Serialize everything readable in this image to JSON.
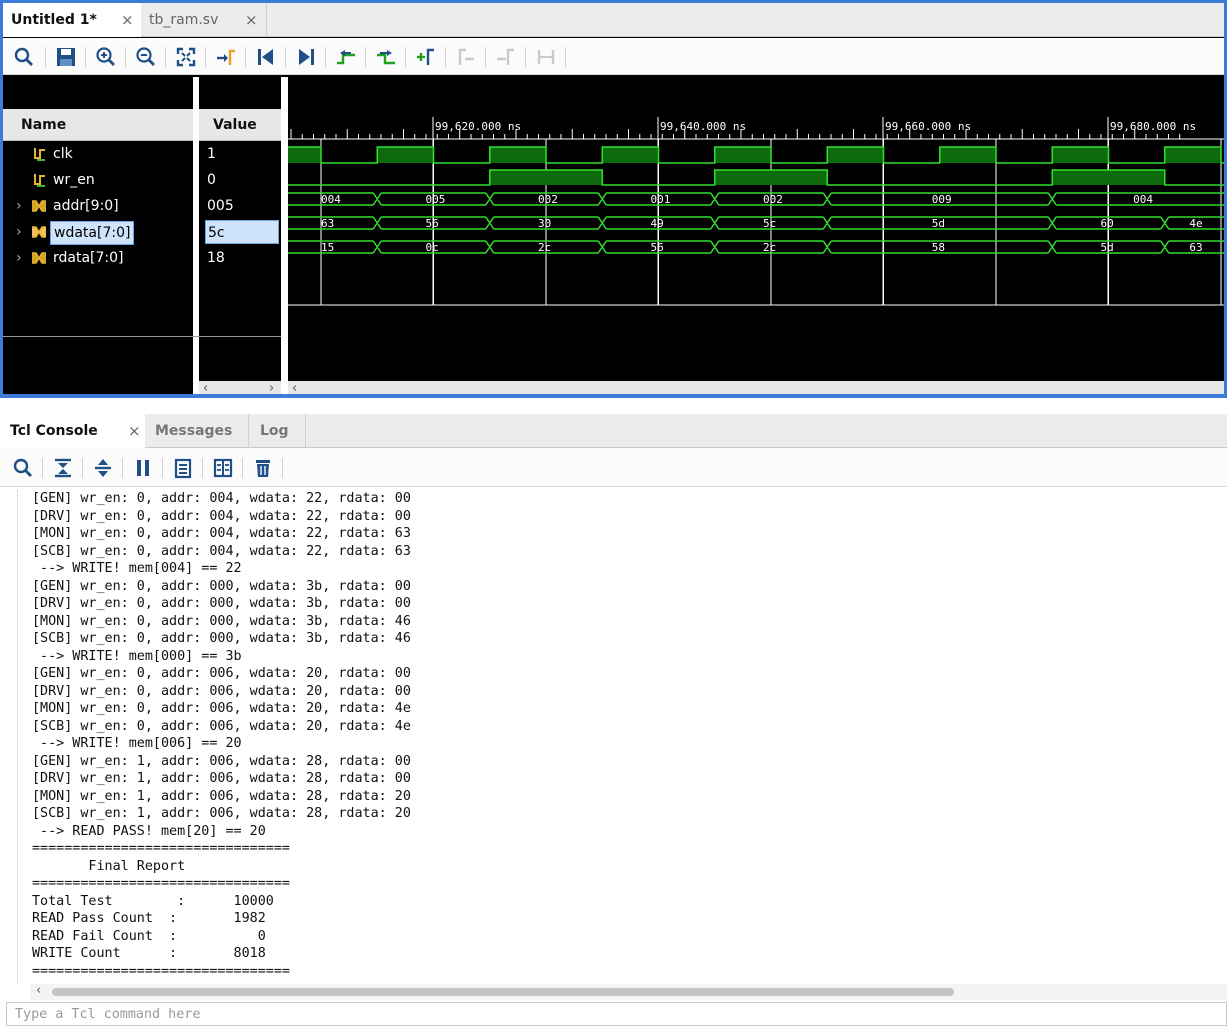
{
  "wave_tabs": [
    {
      "label": "Untitled 1*",
      "active": true
    },
    {
      "label": "tb_ram.sv",
      "active": false
    }
  ],
  "wave_toolbar_icons": [
    "search-icon",
    "save-icon",
    "zoom-in-icon",
    "zoom-out-icon",
    "zoom-fit-icon",
    "go-to-cursor-icon",
    "go-to-time-0-icon",
    "go-to-last-time-icon",
    "previous-transition-icon",
    "next-transition-icon",
    "add-marker-icon",
    "previous-marker-icon",
    "next-marker-icon",
    "swap-cursors-icon"
  ],
  "pane_headers": {
    "name": "Name",
    "value": "Value"
  },
  "signals": [
    {
      "name": "clk",
      "value": "1",
      "kind": "bit"
    },
    {
      "name": "wr_en",
      "value": "0",
      "kind": "bit"
    },
    {
      "name": "addr[9:0]",
      "value": "005",
      "kind": "bus"
    },
    {
      "name": "wdata[7:0]",
      "value": "5c",
      "kind": "bus",
      "selected": true
    },
    {
      "name": "rdata[7:0]",
      "value": "18",
      "kind": "bus"
    }
  ],
  "time_labels": [
    "99,620.000 ns",
    "99,640.000 ns",
    "99,660.000 ns",
    "99,680.000 ns"
  ],
  "waves": {
    "clk": [
      0,
      1,
      0,
      1,
      0,
      1,
      0,
      1,
      0,
      1,
      0,
      1,
      0,
      1,
      0,
      1,
      0,
      1,
      0,
      1,
      0,
      1,
      0,
      1
    ],
    "wr_en": [
      0,
      0,
      0,
      0,
      1,
      1,
      1,
      1,
      0,
      0,
      0,
      0,
      0,
      0,
      1,
      1,
      1,
      1,
      0,
      0,
      0,
      0,
      1,
      1,
      1,
      1,
      0,
      0,
      0,
      0
    ],
    "addr": [
      "004",
      "005",
      "002",
      "001",
      "002",
      "009",
      "004"
    ],
    "wdata": [
      "63",
      "56",
      "30",
      "49",
      "5c",
      "5d",
      "60",
      "4e",
      "18"
    ],
    "rdata": [
      "15",
      "0c",
      "2c",
      "56",
      "2c",
      "58",
      "5d",
      "63",
      "56"
    ]
  },
  "console_tabs": [
    {
      "label": "Tcl Console",
      "active": true
    },
    {
      "label": "Messages",
      "active": false
    },
    {
      "label": "Log",
      "active": false
    }
  ],
  "console_toolbar_icons": [
    "search-icon",
    "collapse-all-icon",
    "expand-all-icon",
    "pause-icon",
    "copy-icon",
    "columns-icon",
    "clear-icon"
  ],
  "console_lines": [
    "[GEN] wr_en: 0, addr: 004, wdata: 22, rdata: 00",
    "[DRV] wr_en: 0, addr: 004, wdata: 22, rdata: 00",
    "[MON] wr_en: 0, addr: 004, wdata: 22, rdata: 63",
    "[SCB] wr_en: 0, addr: 004, wdata: 22, rdata: 63",
    " --> WRITE! mem[004] == 22",
    "[GEN] wr_en: 0, addr: 000, wdata: 3b, rdata: 00",
    "[DRV] wr_en: 0, addr: 000, wdata: 3b, rdata: 00",
    "[MON] wr_en: 0, addr: 000, wdata: 3b, rdata: 46",
    "[SCB] wr_en: 0, addr: 000, wdata: 3b, rdata: 46",
    " --> WRITE! mem[000] == 3b",
    "[GEN] wr_en: 0, addr: 006, wdata: 20, rdata: 00",
    "[DRV] wr_en: 0, addr: 006, wdata: 20, rdata: 00",
    "[MON] wr_en: 0, addr: 006, wdata: 20, rdata: 4e",
    "[SCB] wr_en: 0, addr: 006, wdata: 20, rdata: 4e",
    " --> WRITE! mem[006] == 20",
    "[GEN] wr_en: 1, addr: 006, wdata: 28, rdata: 00",
    "[DRV] wr_en: 1, addr: 006, wdata: 28, rdata: 00",
    "[MON] wr_en: 1, addr: 006, wdata: 28, rdata: 20",
    "[SCB] wr_en: 1, addr: 006, wdata: 28, rdata: 20",
    " --> READ PASS! mem[20] == 20",
    "================================",
    "       Final Report",
    "================================",
    "Total Test        :      10000",
    "READ Pass Count  :       1982",
    "READ Fail Count  :          0",
    "WRITE Count      :       8018",
    "================================"
  ],
  "command_placeholder": "Type a Tcl command here",
  "colors": {
    "wave": "#2ee02e",
    "wave_fill": "#0d6b0d",
    "accent": "#3d7bd9",
    "selection": "#cfe3fa"
  }
}
